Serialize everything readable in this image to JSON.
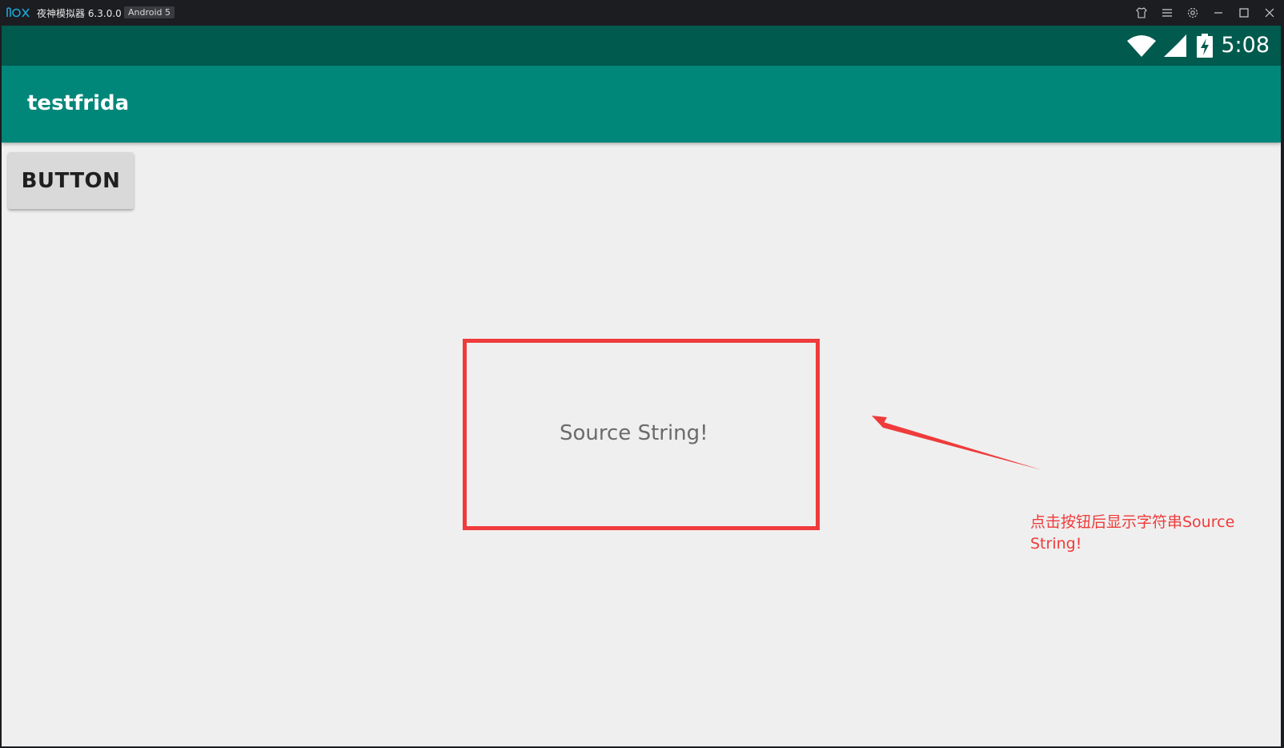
{
  "emulator": {
    "title": "夜神模拟器 6.3.0.0",
    "badge": "Android 5",
    "controls": [
      "shirt-icon",
      "menu-icon",
      "gear-icon",
      "minimize-icon",
      "maximize-icon",
      "close-icon"
    ]
  },
  "status_bar": {
    "time": "5:08",
    "icons": [
      "wifi-icon",
      "signal-icon",
      "battery-charging-icon"
    ]
  },
  "app": {
    "title": "testfrida",
    "button_label": "BUTTON",
    "output_text": "Source String!"
  },
  "annotation": {
    "note": "点击按钮后显示字符串Source String!",
    "color": "#ef3b3b"
  },
  "colors": {
    "status_bar": "#005a4e",
    "app_bar": "#00877a",
    "background": "#efefef",
    "button": "#d9d9d9"
  }
}
